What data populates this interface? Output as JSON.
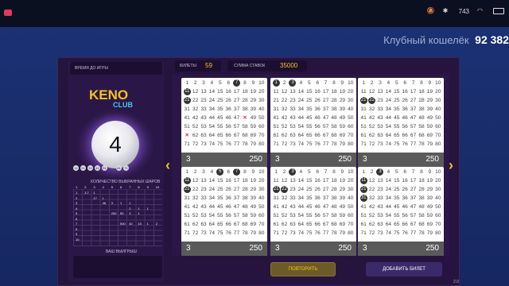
{
  "status_bar": {
    "rate": "743\nКБ/S",
    "time_icons": [
      "mute-icon",
      "bluetooth-icon",
      "wifi-icon",
      "battery-icon"
    ]
  },
  "wallet": {
    "label": "Клубный кошелёк",
    "amount": "92 382"
  },
  "left_panel": {
    "timer_label": "ВРЕМЯ ДО ИГРЫ",
    "logo_keno": "KENO",
    "logo_club": "CLUB",
    "ball_value": "4",
    "mini_balls": [
      "11",
      "21",
      "31",
      "41",
      "51",
      "",
      "61",
      "71"
    ],
    "paytable_title": "КОЛИЧЕСТВО ВЫБРАННЫХ ШАРОВ",
    "paytable_header": [
      "1",
      "2",
      "3",
      "4",
      "5",
      "6",
      "7",
      "8",
      "9",
      "10"
    ],
    "paytable_rows": [
      [
        "1",
        "3.7",
        "1",
        "",
        "",
        "",
        "",
        "",
        "",
        ""
      ],
      [
        "2",
        "",
        "17",
        "1",
        "",
        "",
        "",
        "",
        "",
        ""
      ],
      [
        "3",
        "",
        "",
        "46",
        "3",
        "1",
        "1",
        "",
        "",
        ""
      ],
      [
        "4",
        "",
        "",
        "",
        "",
        "",
        "2",
        "1",
        "1",
        ""
      ],
      [
        "5",
        "",
        "",
        "",
        "200",
        "50",
        "3",
        "1",
        "",
        ""
      ],
      [
        "6",
        "",
        "",
        "",
        "",
        "",
        "",
        "",
        "",
        ""
      ],
      [
        "7",
        "",
        "",
        "",
        "",
        "500",
        "40",
        "15",
        "1",
        "2"
      ],
      [
        "8",
        "",
        "",
        "",
        "",
        "",
        "",
        "",
        "",
        ""
      ],
      [
        "9",
        "",
        "",
        "",
        "",
        "",
        "",
        "",
        "",
        ""
      ],
      [
        "10",
        "",
        "",
        "",
        "",
        "",
        "",
        "",
        "",
        ""
      ]
    ],
    "wins_label": "ВАШ ВЫИГРЫШ"
  },
  "info": {
    "tickets_label": "БИЛЕТЫ",
    "tickets_value": "59",
    "sum_label": "СУММА СТАВОК",
    "sum_value": "35000"
  },
  "tickets": [
    {
      "left": "3",
      "right": "250",
      "marked": [
        7
      ],
      "crossed": [
        48,
        61
      ],
      "hi": [
        11,
        21
      ]
    },
    {
      "left": "3",
      "right": "250",
      "marked": [
        1,
        3
      ],
      "crossed": [],
      "hi": []
    },
    {
      "left": "3",
      "right": "250",
      "marked": [
        21,
        22
      ],
      "crossed": [],
      "hi": []
    },
    {
      "left": "3",
      "right": "250",
      "marked": [
        5,
        7
      ],
      "crossed": [],
      "hi": [
        11,
        21
      ]
    },
    {
      "left": "3",
      "right": "250",
      "marked": [
        3
      ],
      "crossed": [],
      "hi": [
        21,
        22
      ]
    },
    {
      "left": "3",
      "right": "250",
      "marked": [
        3
      ],
      "crossed": [],
      "hi": [
        11,
        21,
        31
      ]
    }
  ],
  "buttons": {
    "repeat": "ПОВТОРИТЬ",
    "add": "ДОБАВИТЬ БИЛЕТ"
  },
  "version": "2.0",
  "colors": {
    "accent": "#f4c21c",
    "panel": "#2b1747",
    "bg": "#1c3275"
  }
}
